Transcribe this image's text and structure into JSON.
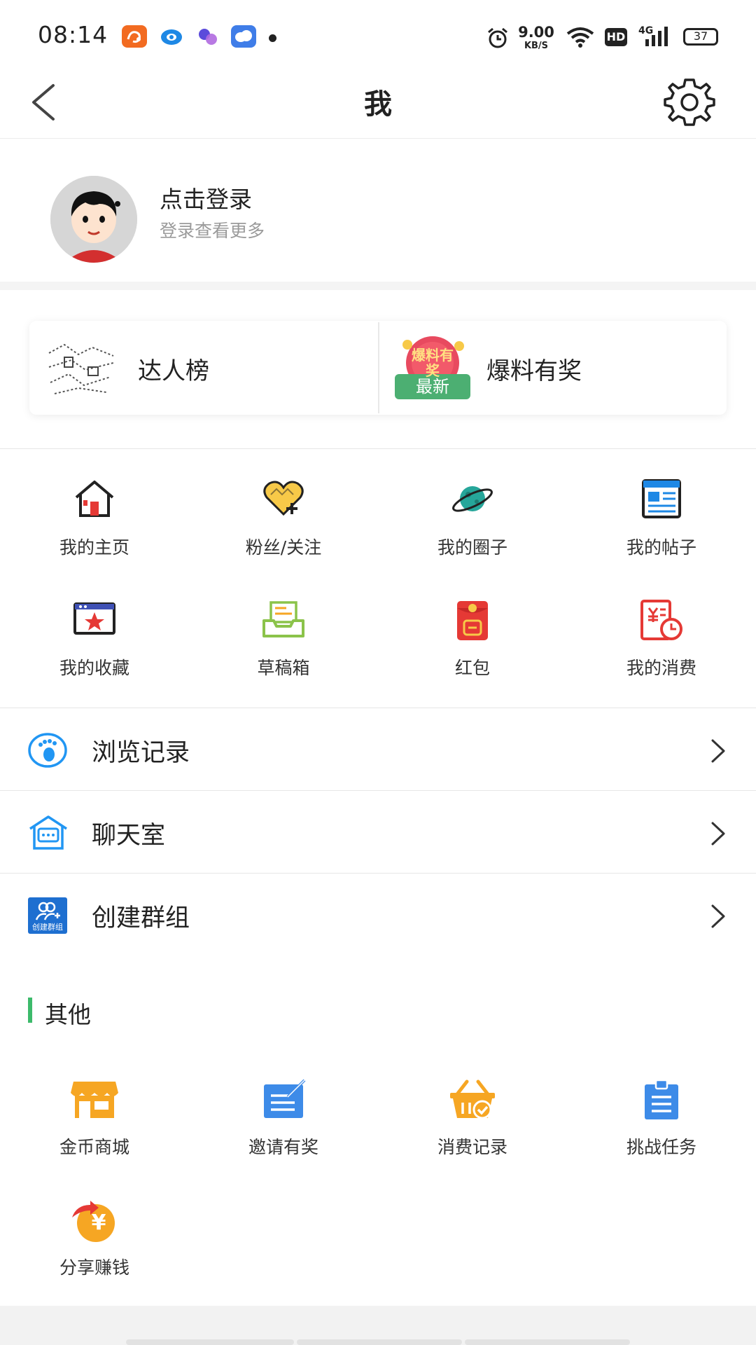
{
  "status_bar": {
    "time": "08:14",
    "net_speed_value": "9.00",
    "net_speed_unit": "KB/S",
    "battery": "37",
    "hd_badge": "HD",
    "network": "4G",
    "app_icons": [
      "uc-browser-icon",
      "eye-app-icon",
      "chat-bubble-app-icon",
      "cloud-app-icon"
    ]
  },
  "nav": {
    "title": "我"
  },
  "profile": {
    "title": "点击登录",
    "subtitle": "登录查看更多"
  },
  "banners": [
    {
      "label": "达人榜"
    },
    {
      "label": "爆料有奖",
      "badge": "最新",
      "art_text": "爆料有奖"
    }
  ],
  "grid": [
    {
      "label": "我的主页",
      "icon": "home-icon"
    },
    {
      "label": "粉丝/关注",
      "icon": "heart-plus-icon"
    },
    {
      "label": "我的圈子",
      "icon": "planet-icon"
    },
    {
      "label": "我的帖子",
      "icon": "article-icon"
    },
    {
      "label": "我的收藏",
      "icon": "star-window-icon"
    },
    {
      "label": "草稿箱",
      "icon": "draft-tray-icon"
    },
    {
      "label": "红包",
      "icon": "red-envelope-icon"
    },
    {
      "label": "我的消费",
      "icon": "receipt-clock-icon"
    }
  ],
  "list": [
    {
      "label": "浏览记录",
      "icon": "footprint-icon"
    },
    {
      "label": "聊天室",
      "icon": "chat-house-icon"
    },
    {
      "label": "创建群组",
      "icon": "create-group-icon",
      "icon_text": "创建群组"
    }
  ],
  "other": {
    "title": "其他",
    "items": [
      {
        "label": "金币商城",
        "icon": "shop-icon"
      },
      {
        "label": "邀请有奖",
        "icon": "invite-edit-icon"
      },
      {
        "label": "消费记录",
        "icon": "basket-check-icon"
      },
      {
        "label": "挑战任务",
        "icon": "clipboard-icon"
      },
      {
        "label": "分享赚钱",
        "icon": "share-yen-icon",
        "icon_text": "¥"
      }
    ]
  },
  "colors": {
    "accent_green": "#3cba6b",
    "orange": "#f6a623",
    "blue": "#2f8fe0",
    "red": "#e53935"
  }
}
